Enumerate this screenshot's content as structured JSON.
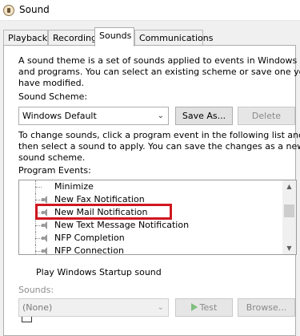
{
  "window": {
    "title": "Sound"
  },
  "tabs": [
    {
      "label": "Playback"
    },
    {
      "label": "Recording"
    },
    {
      "label": "Sounds"
    },
    {
      "label": "Communications"
    }
  ],
  "sounds_tab": {
    "intro_lines": [
      "A sound theme is a set of sounds applied to events in Windows",
      "and programs.  You can select an existing scheme or save one you",
      "have modified."
    ],
    "scheme_label": "Sound Scheme:",
    "scheme_value": "Windows Default",
    "save_as_label": "Save As...",
    "delete_label": "Delete",
    "instructions_lines": [
      "To change sounds, click a program event in the following list and",
      "then select a sound to apply.  You can save the changes as a new",
      "sound scheme."
    ],
    "events_label": "Program Events:",
    "events": [
      {
        "label": "Minimize",
        "has_sound": false
      },
      {
        "label": "New Fax Notification",
        "has_sound": true
      },
      {
        "label": "New Mail Notification",
        "has_sound": true,
        "highlighted": true
      },
      {
        "label": "New Text Message Notification",
        "has_sound": true
      },
      {
        "label": "NFP Completion",
        "has_sound": true
      },
      {
        "label": "NFP Connection",
        "has_sound": true
      }
    ],
    "startup_checkbox_label": "Play Windows Startup sound",
    "startup_checked": false,
    "sounds_label": "Sounds:",
    "sounds_value": "(None)",
    "test_label": "Test",
    "browse_label": "Browse..."
  },
  "colors": {
    "highlight_border": "#d0161f",
    "panel_bg": "#ffffff",
    "window_bg": "#f0f0f0"
  }
}
